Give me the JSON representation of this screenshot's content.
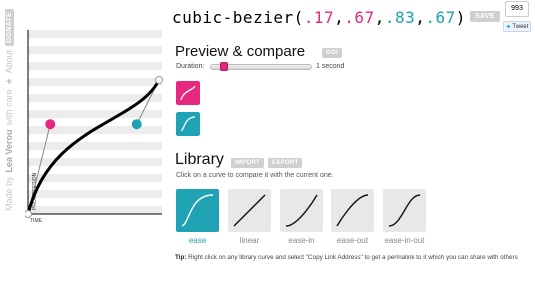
{
  "credit": {
    "made_by": "Made by",
    "author": "Lea Verou",
    "with_care": "with care",
    "star": "★",
    "about": "About",
    "donate": "DONATE"
  },
  "graph": {
    "y_label": "PROGRESSION",
    "x_label": "TIME",
    "bezier": [
      0.17,
      0.67,
      0.83,
      0.67
    ],
    "colors": {
      "p1": "#e6287f",
      "p2": "#1ea2b4",
      "curve": "#000000"
    }
  },
  "header": {
    "fn_open": "cubic-bezier(",
    "v1": ".17",
    "c1": ",",
    "v2": ".67",
    "c2": ",",
    "v3": ".83",
    "c3": ",",
    "v4": ".67",
    "fn_close": ")",
    "save_label": "SAVE",
    "tweet_count": "993",
    "tweet_label": "Tweet"
  },
  "preview": {
    "heading": "Preview & compare",
    "go_label": "GO!",
    "duration_label": "Duration:",
    "duration_value": "1 second",
    "duration_fraction": 0.1,
    "box_colors": [
      "#e6287f",
      "#1ea2b4"
    ]
  },
  "library": {
    "heading": "Library",
    "import_label": "IMPORT",
    "export_label": "EXPORT",
    "description": "Click on a curve to compare it with the current one.",
    "curves": [
      {
        "name": "ease",
        "bezier": [
          0.25,
          0.1,
          0.25,
          1
        ],
        "selected": true
      },
      {
        "name": "linear",
        "bezier": [
          0,
          0,
          1,
          1
        ],
        "selected": false
      },
      {
        "name": "ease-in",
        "bezier": [
          0.42,
          0,
          1,
          1
        ],
        "selected": false
      },
      {
        "name": "ease-out",
        "bezier": [
          0,
          0,
          0.58,
          1
        ],
        "selected": false
      },
      {
        "name": "ease-in-out",
        "bezier": [
          0.42,
          0,
          0.58,
          1
        ],
        "selected": false
      }
    ],
    "tip_label": "Tip:",
    "tip_text": " Right click on any library curve and select \"Copy Link Address\" to get a permalink to it which you can share with others"
  }
}
